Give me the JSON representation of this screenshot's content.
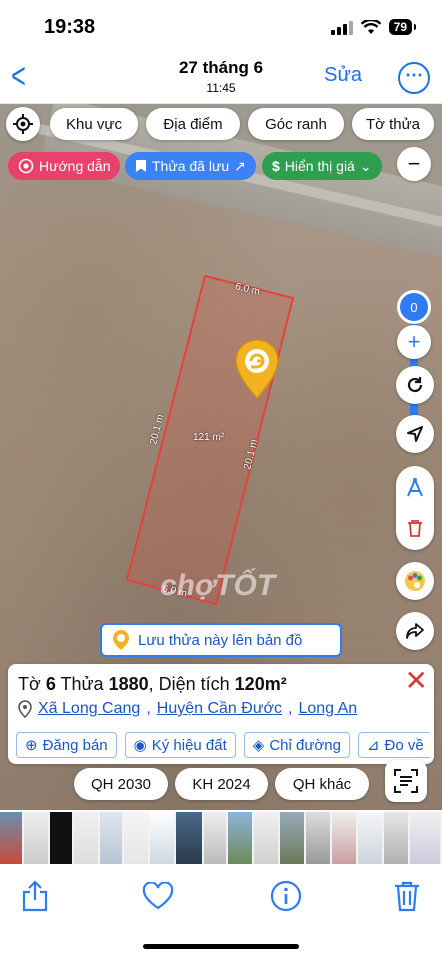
{
  "status": {
    "time": "19:38",
    "battery": "79"
  },
  "nav": {
    "title": "27 tháng 6",
    "subtitle": "11:45",
    "edit_label": "Sửa",
    "more_label": "⋯"
  },
  "map": {
    "filters": [
      "Khu vực",
      "Địa điểm",
      "Góc ranh",
      "Tờ thửa"
    ],
    "tags": {
      "guide": "Hướng dẫn",
      "saved": "Thửa đã lưu",
      "price": "Hiển thị giá"
    },
    "slider": {
      "value": "0",
      "minus": "−",
      "plus": "+"
    },
    "parcel": {
      "top_edge": "6.0 m",
      "bottom_edge": "6.0 m",
      "left_edge": "20.1 m",
      "right_edge": "20.1 m",
      "area": "121 m²"
    },
    "watermark": "chợTỐT",
    "save_banner": "Lưu thửa này lên bản đồ"
  },
  "info": {
    "title_prefix": "Tờ ",
    "sheet": "6",
    "title_mid": " Thửa ",
    "parcel": "1880",
    "title_area_prefix": ", Diện tích ",
    "area": "120m²",
    "commune": "Xã Long Cang",
    "district": "Huyện Cần Đước",
    "province": "Long An",
    "actions": [
      "Đăng bán",
      "Ký hiệu đất",
      "Chỉ đường",
      "Đo về"
    ]
  },
  "plans": [
    "QH 2030",
    "KH 2024",
    "QH khác"
  ],
  "colors": {
    "accent": "#2f7bf0",
    "guide_tag": "#e8416a",
    "saved_tag": "#3b82f6",
    "price_tag": "#2e9e4f",
    "parcel_outline": "#e8403a"
  }
}
